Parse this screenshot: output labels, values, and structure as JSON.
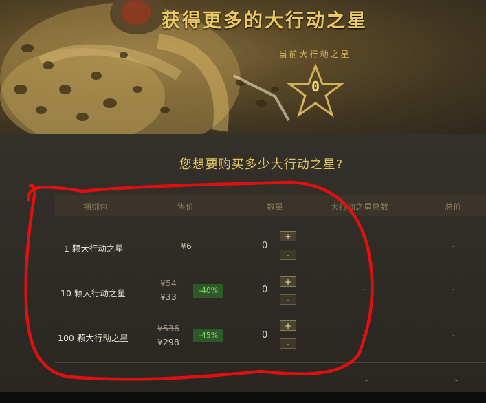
{
  "header": {
    "title": "获得更多的大行动之星",
    "current_label": "当前大行动之星",
    "current_count": "0"
  },
  "question": "您想要购买多少大行动之星?",
  "table": {
    "columns": [
      "捆绑包",
      "售价",
      "数量",
      "大行动之星总数",
      "总价"
    ],
    "rows": [
      {
        "name": "1 颗大行动之星",
        "price": "¥6",
        "old_price": "",
        "discount": "",
        "quantity": "0",
        "plus": "+",
        "minus": "-",
        "total_stars": "",
        "total_price": "-"
      },
      {
        "name": "10 颗大行动之星",
        "price": "¥33",
        "old_price": "¥54",
        "discount": "-40%",
        "quantity": "0",
        "plus": "+",
        "minus": "-",
        "total_stars": "-",
        "total_price": "-"
      },
      {
        "name": "100 颗大行动之星",
        "price": "¥298",
        "old_price": "¥536",
        "discount": "-45%",
        "quantity": "0",
        "plus": "+",
        "minus": "-",
        "total_stars": "-",
        "total_price": "-"
      }
    ],
    "footer_total_stars": "-",
    "footer_total_price": "-"
  },
  "colors": {
    "accent_gold": "#e8c964",
    "discount_green": "#7fd46a",
    "annotation_red": "#e01010"
  }
}
